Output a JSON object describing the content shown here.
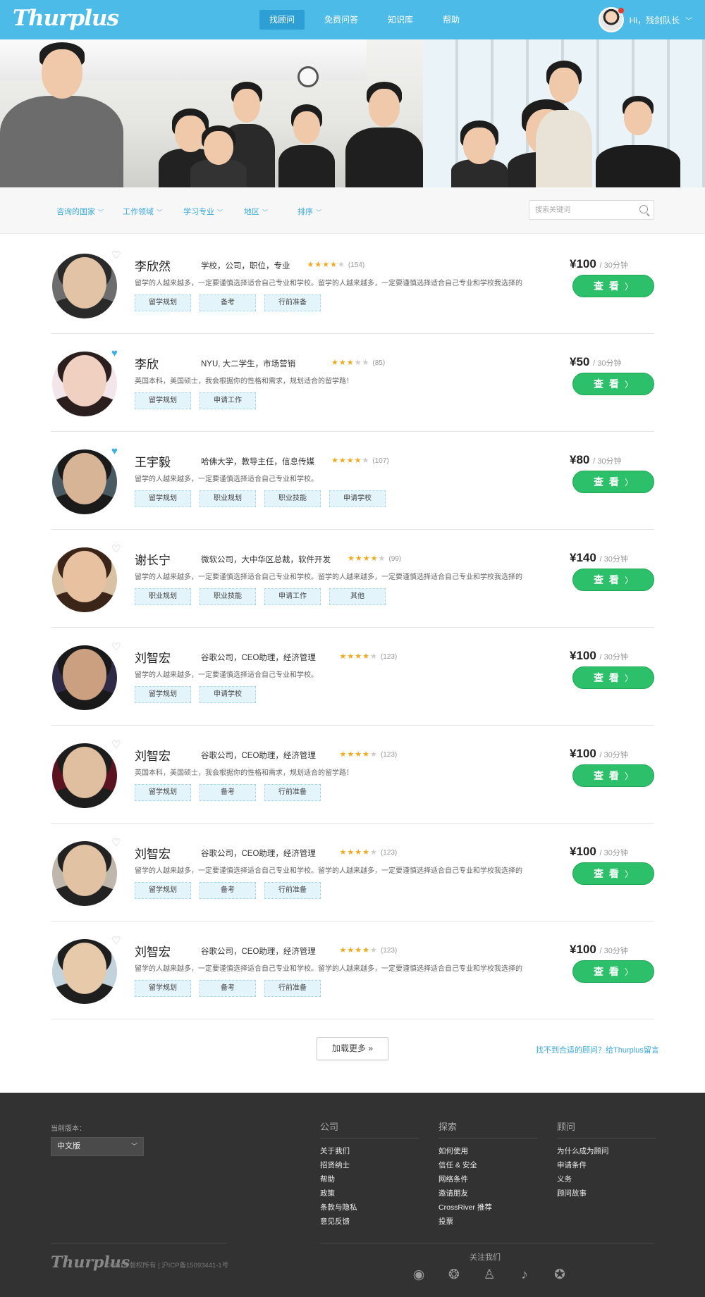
{
  "header": {
    "logo": "Thurplus",
    "nav": [
      "找顾问",
      "免费问答",
      "知识库",
      "帮助"
    ],
    "user_greeting": "Hi，残剑队长"
  },
  "filters": {
    "items": [
      "咨询的国家",
      "工作领域",
      "学习专业",
      "地区",
      "排序"
    ],
    "search_placeholder": "搜索关键词"
  },
  "advisors": [
    {
      "name": "李欣然",
      "title": "学校，公司，职位，专业",
      "rating": 4,
      "reviews": "(154)",
      "desc": "留学的人越来越多，一定要谨慎选择适合自己专业和学校。留学的人越来越多，一定要谨慎选择适合自己专业和学校我选择的",
      "tags": [
        "留学规划",
        "备考",
        "行前准备"
      ],
      "price": "¥100",
      "unit": "/ 30分钟",
      "button": "查 看",
      "favorited": false
    },
    {
      "name": "李欣",
      "title": "NYU, 大二学生，市场营销",
      "rating": 3,
      "reviews": "(85)",
      "desc": "英国本科，美国硕士，我会根据你的性格和需求，规划适合的留学路！",
      "tags": [
        "留学规划",
        "申请工作"
      ],
      "price": "¥50",
      "unit": "/ 30分钟",
      "button": "查 看",
      "favorited": true
    },
    {
      "name": "王宇毅",
      "title": "哈佛大学，教导主任，信息传媒",
      "rating": 4,
      "reviews": "(107)",
      "desc": "留学的人越来越多，一定要谨慎选择适合自己专业和学校。",
      "tags": [
        "留学规划",
        "职业规划",
        "职业技能",
        "申请学校"
      ],
      "price": "¥80",
      "unit": "/ 30分钟",
      "button": "查 看",
      "favorited": true
    },
    {
      "name": "谢长宁",
      "title": "微软公司，大中华区总裁，软件开发",
      "rating": 4,
      "reviews": "(99)",
      "desc": "留学的人越来越多，一定要谨慎选择适合自己专业和学校。留学的人越来越多，一定要谨慎选择适合自己专业和学校我选择的",
      "tags": [
        "职业规划",
        "职业技能",
        "申请工作",
        "其他"
      ],
      "price": "¥140",
      "unit": "/ 30分钟",
      "button": "查 看",
      "favorited": false
    },
    {
      "name": "刘智宏",
      "title": "谷歌公司，CEO助理，经济管理",
      "rating": 4,
      "reviews": "(123)",
      "desc": "留学的人越来越多，一定要谨慎选择适合自己专业和学校。",
      "tags": [
        "留学规划",
        "申请学校"
      ],
      "price": "¥100",
      "unit": "/ 30分钟",
      "button": "查 看",
      "favorited": false
    },
    {
      "name": "刘智宏",
      "title": "谷歌公司，CEO助理，经济管理",
      "rating": 4,
      "reviews": "(123)",
      "desc": "英国本科，美国硕士，我会根据你的性格和需求，规划适合的留学路！",
      "tags": [
        "留学规划",
        "备考",
        "行前准备"
      ],
      "price": "¥100",
      "unit": "/ 30分钟",
      "button": "查 看",
      "favorited": false
    },
    {
      "name": "刘智宏",
      "title": "谷歌公司，CEO助理，经济管理",
      "rating": 4,
      "reviews": "(123)",
      "desc": "留学的人越来越多，一定要谨慎选择适合自己专业和学校。留学的人越来越多，一定要谨慎选择适合自己专业和学校我选择的",
      "tags": [
        "留学规划",
        "备考",
        "行前准备"
      ],
      "price": "¥100",
      "unit": "/ 30分钟",
      "button": "查 看",
      "favorited": false
    },
    {
      "name": "刘智宏",
      "title": "谷歌公司，CEO助理，经济管理",
      "rating": 4,
      "reviews": "(123)",
      "desc": "留学的人越来越多，一定要谨慎选择适合自己专业和学校。留学的人越来越多，一定要谨慎选择适合自己专业和学校我选择的",
      "tags": [
        "留学规划",
        "备考",
        "行前准备"
      ],
      "price": "¥100",
      "unit": "/ 30分钟",
      "button": "查 看",
      "favorited": false
    }
  ],
  "list_footer": {
    "load_more": "加载更多 »",
    "leave_message": "找不到合适的顾问？给Thurplus留言"
  },
  "footer": {
    "version_label": "当前版本：",
    "version_value": "中文版",
    "columns": [
      {
        "title": "公司",
        "links": [
          "关于我们",
          "招贤纳士",
          "帮助",
          "政策",
          "条款与隐私",
          "意见反馈"
        ]
      },
      {
        "title": "探索",
        "links": [
          "如何使用",
          "信任 & 安全",
          "网络条件",
          "邀请朋友",
          "CrossRiver 推荐",
          "投票"
        ]
      },
      {
        "title": "顾问",
        "links": [
          "为什么成为顾问",
          "申请条件",
          "义务",
          "顾问故事"
        ]
      }
    ],
    "logo": "Thurplus",
    "copyright": "© 2015 版权所有 | 沪ICP备15093441-1号",
    "follow": "关注我们",
    "socials": [
      "weibo-icon",
      "wechat-icon",
      "qq-icon",
      "douban-icon",
      "star-icon"
    ]
  },
  "colors": {
    "brand": "#4cbbe8",
    "green": "#2cc06a",
    "star": "#f0a81c",
    "footer": "#323232"
  }
}
